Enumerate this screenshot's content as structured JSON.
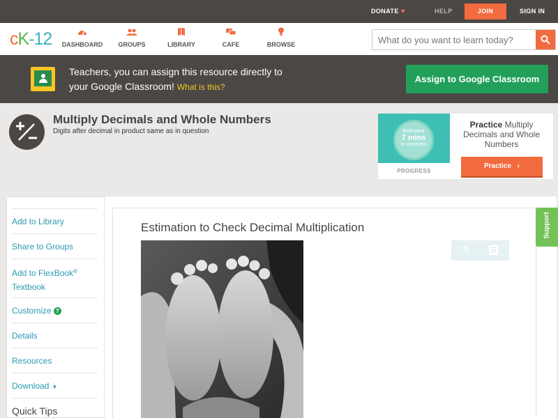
{
  "topbar": {
    "donate": "DONATE",
    "help": "HELP",
    "join": "JOIN",
    "sign_in": "SIGN IN"
  },
  "logo": {
    "c": "c",
    "k": "K",
    "dash": "-",
    "num": "12"
  },
  "nav": {
    "items": [
      {
        "label": "DASHBOARD",
        "icon": "dashboard-icon"
      },
      {
        "label": "GROUPS",
        "icon": "groups-icon"
      },
      {
        "label": "LIBRARY",
        "icon": "library-icon"
      },
      {
        "label": "CAFE",
        "icon": "cafe-icon"
      },
      {
        "label": "BROWSE",
        "icon": "browse-icon"
      }
    ],
    "search_placeholder": "What do you want to learn today?"
  },
  "banner": {
    "line1": "Teachers, you can assign this resource directly to",
    "line2": "your Google Classroom!",
    "what_link": "What is this?",
    "assign_button": "Assign to Google Classroom"
  },
  "concept": {
    "title": "Multiply Decimals and Whole Numbers",
    "subtitle": "Digits after decimal in product same as in question"
  },
  "practice": {
    "estimated": "Estimated",
    "mins": "7 mins",
    "to_complete": "to complete",
    "progress_label": "PROGRESS",
    "bold": "Practice",
    "rest": " Multiply Decimals and Whole Numbers",
    "button": "Practice"
  },
  "sidebar": {
    "items": [
      "Add to Library",
      "Share to Groups",
      "Add to FlexBook",
      "Textbook",
      "Customize",
      "Details",
      "Resources",
      "Download",
      "Quick Tips"
    ],
    "flexbook_sup": "®"
  },
  "content": {
    "title": "Estimation to Check Decimal Multiplication"
  },
  "support_tab": "Support",
  "colors": {
    "accent_orange": "#f26b3f",
    "assign_green": "#22a05a",
    "link_teal": "#2a9ab0",
    "dark_bar": "#4a4745"
  }
}
